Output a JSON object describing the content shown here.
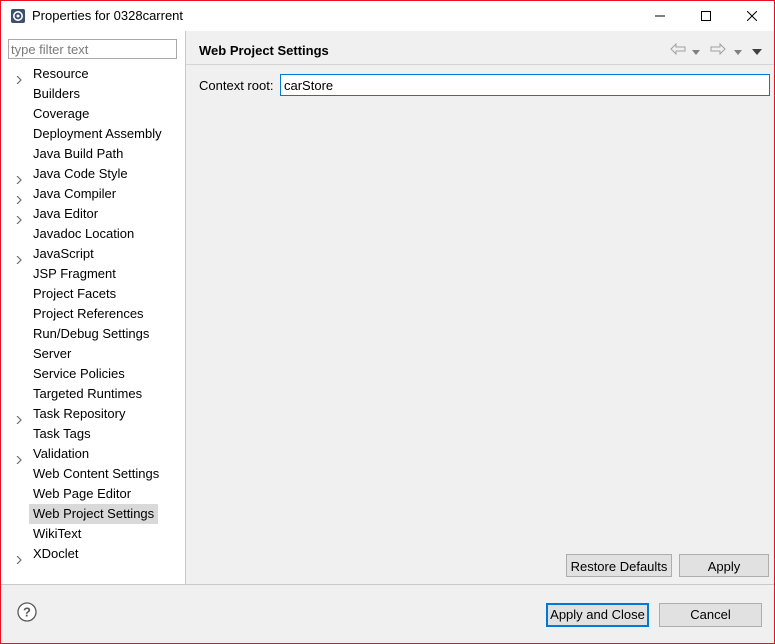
{
  "window": {
    "title": "Properties for 0328carrent",
    "accent_color": "#e81123"
  },
  "filter": {
    "placeholder": "type filter text",
    "value": ""
  },
  "tree": {
    "items": [
      {
        "label": "Resource",
        "expandable": true
      },
      {
        "label": "Builders",
        "expandable": false
      },
      {
        "label": "Coverage",
        "expandable": false
      },
      {
        "label": "Deployment Assembly",
        "expandable": false
      },
      {
        "label": "Java Build Path",
        "expandable": false
      },
      {
        "label": "Java Code Style",
        "expandable": true
      },
      {
        "label": "Java Compiler",
        "expandable": true
      },
      {
        "label": "Java Editor",
        "expandable": true
      },
      {
        "label": "Javadoc Location",
        "expandable": false
      },
      {
        "label": "JavaScript",
        "expandable": true
      },
      {
        "label": "JSP Fragment",
        "expandable": false
      },
      {
        "label": "Project Facets",
        "expandable": false
      },
      {
        "label": "Project References",
        "expandable": false
      },
      {
        "label": "Run/Debug Settings",
        "expandable": false
      },
      {
        "label": "Server",
        "expandable": false
      },
      {
        "label": "Service Policies",
        "expandable": false
      },
      {
        "label": "Targeted Runtimes",
        "expandable": false
      },
      {
        "label": "Task Repository",
        "expandable": true
      },
      {
        "label": "Task Tags",
        "expandable": false
      },
      {
        "label": "Validation",
        "expandable": true
      },
      {
        "label": "Web Content Settings",
        "expandable": false
      },
      {
        "label": "Web Page Editor",
        "expandable": false
      },
      {
        "label": "Web Project Settings",
        "expandable": false,
        "selected": true
      },
      {
        "label": "WikiText",
        "expandable": false
      },
      {
        "label": "XDoclet",
        "expandable": true
      }
    ]
  },
  "page": {
    "title": "Web Project Settings",
    "context_root_label": "Context root:",
    "context_root_value": "carStore"
  },
  "buttons": {
    "restore_defaults": "Restore Defaults",
    "apply": "Apply",
    "apply_and_close": "Apply and Close",
    "cancel": "Cancel"
  },
  "icons": {
    "app": "eclipse-gear-icon",
    "minimize": "minimize-icon",
    "maximize": "maximize-icon",
    "close": "close-icon",
    "back": "back-arrow-icon",
    "forward": "forward-arrow-icon",
    "menu": "view-menu-icon",
    "help": "help-icon"
  }
}
